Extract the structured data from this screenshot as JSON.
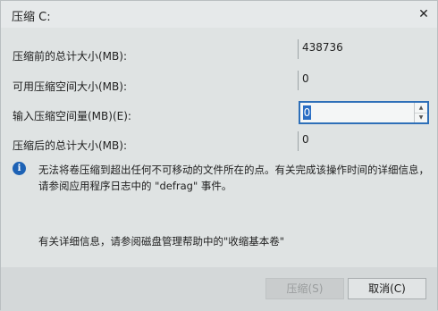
{
  "window": {
    "title": "压缩 C:",
    "close_glyph": "✕"
  },
  "rows": [
    {
      "label": "压缩前的总计大小(MB):",
      "value": "438736"
    },
    {
      "label": "可用压缩空间大小(MB):",
      "value": "0"
    },
    {
      "label": "输入压缩空间量(MB)(E):",
      "value": "0"
    },
    {
      "label": "压缩后的总计大小(MB):",
      "value": "0"
    }
  ],
  "info": {
    "icon": "info-icon",
    "icon_glyph": "i",
    "icon_color": "#1d62b5",
    "text": "无法将卷压缩到超出任何不可移动的文件所在的点。有关完成该操作时间的详细信息，请参阅应用程序日志中的 \"defrag\" 事件。"
  },
  "help": {
    "text": "有关详细信息，请参阅磁盘管理帮助中的\"收缩基本卷\""
  },
  "buttons": {
    "shrink_label": "压缩(S)",
    "cancel_label": "取消(C)"
  },
  "spinner": {
    "up_glyph": "▲",
    "down_glyph": "▼",
    "focus_color": "#2d6fb8"
  }
}
